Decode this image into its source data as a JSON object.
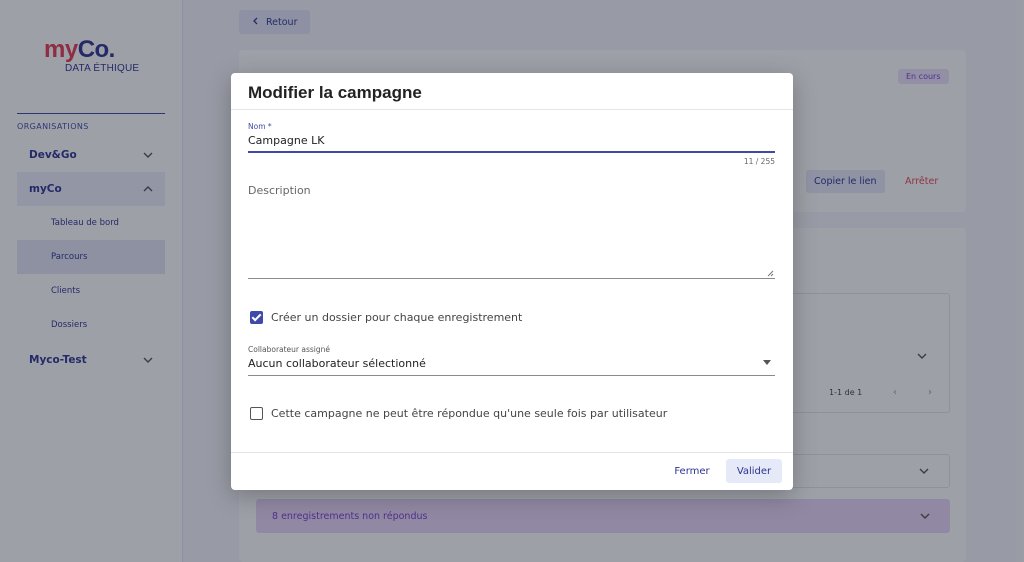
{
  "brand": {
    "logo_my": "my",
    "logo_co": "Co.",
    "logo_sub": "DATA ÉTHIQUE"
  },
  "sidebar": {
    "section_label": "ORGANISATIONS",
    "items": [
      {
        "label": "Dev&Go",
        "expanded": false
      },
      {
        "label": "myCo",
        "expanded": true,
        "children": [
          {
            "label": "Tableau de bord"
          },
          {
            "label": "Parcours",
            "selected": true
          },
          {
            "label": "Clients"
          },
          {
            "label": "Dossiers"
          }
        ]
      },
      {
        "label": "Myco-Test",
        "expanded": false
      }
    ]
  },
  "page": {
    "back_label": "Retour",
    "status_badge": "En cours",
    "copy_link_label": "Copier le lien",
    "stop_label": "Arrêter",
    "pagination": "1-1 de 1",
    "unanswered_label": "8 enregistrements non répondus"
  },
  "modal": {
    "title": "Modifier la campagne",
    "name_label": "Nom *",
    "name_value": "Campagne LK",
    "name_counter": "11 / 255",
    "description_label": "Description",
    "create_folder_label": "Créer un dossier pour chaque enregistrement",
    "create_folder_checked": true,
    "collaborator_label": "Collaborateur assigné",
    "collaborator_value": "Aucun collaborateur sélectionné",
    "single_answer_label": "Cette campagne ne peut être répondue qu'une seule fois par utilisateur",
    "single_answer_checked": false,
    "close_label": "Fermer",
    "validate_label": "Valider"
  },
  "colors": {
    "primary": "#3f4aa8",
    "brand_red": "#e53950",
    "brand_blue": "#2c3490",
    "danger": "#e5484d",
    "badge_bg": "#ede3fb",
    "unanswered_bg": "#e8d6f7"
  }
}
